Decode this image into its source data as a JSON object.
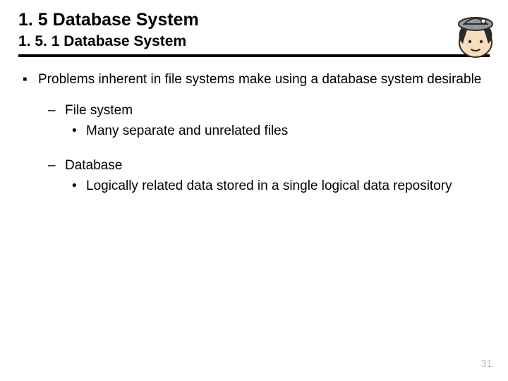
{
  "heading": "1. 5 Database System",
  "subheading": "1. 5. 1 Database System",
  "body": {
    "item1": {
      "text": "Problems inherent in file systems make using a database system desirable",
      "sub1": {
        "label": "File system",
        "point": "Many separate and unrelated files"
      },
      "sub2": {
        "label": "Database",
        "point": "Logically related data stored in a single logical data repository"
      }
    }
  },
  "bullets": {
    "square": "▪",
    "dash": "–",
    "dot": "•"
  },
  "page_number": "31"
}
